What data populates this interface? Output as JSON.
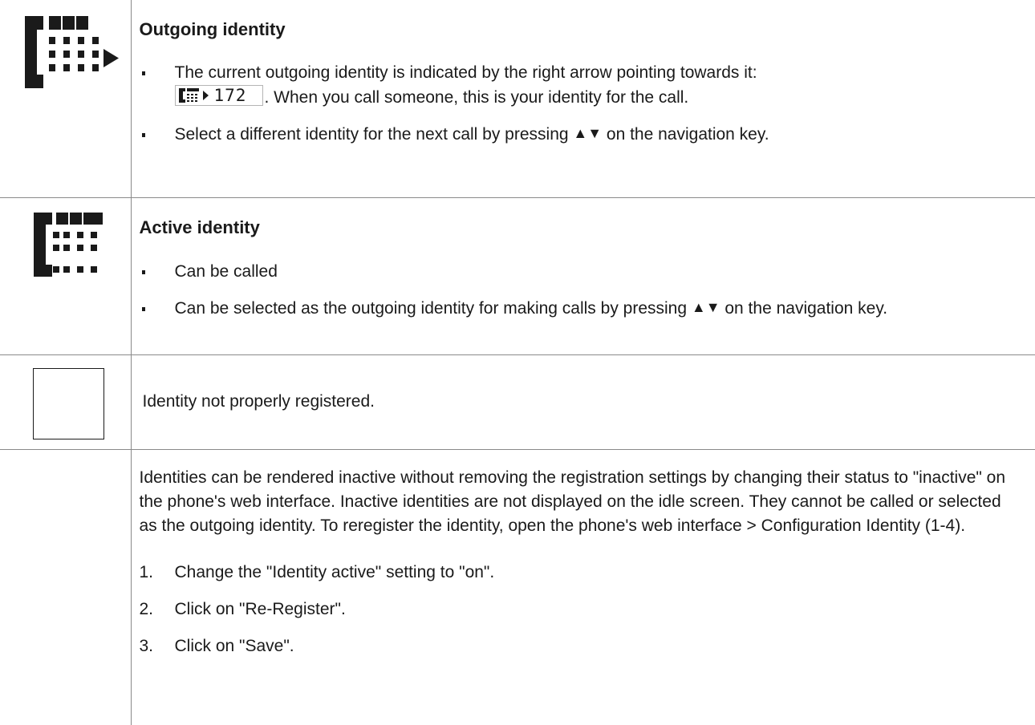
{
  "rows": [
    {
      "heading": "Outgoing identity",
      "bullets": [
        {
          "line1": "The current outgoing identity is indicated by the right arrow pointing towards it:",
          "display_number": "172",
          "after_display": ". When you call someone, this is your identity for the call."
        },
        {
          "before_arrows": "Select a different identity for the next call by pressing",
          "after_arrows": "on the navigation key."
        }
      ]
    },
    {
      "heading": "Active identity",
      "bullets": [
        {
          "text": "Can be called"
        },
        {
          "before_arrows": "Can be selected as the outgoing identity for making calls by pressing",
          "after_arrows": "on the navigation key."
        }
      ]
    },
    {
      "text": "Identity not properly registered."
    },
    {
      "paragraph": "Identities can be rendered inactive without removing the registration settings by changing their status to \"inactive\" on the phone's web interface.  Inactive identities are not displayed on the idle screen.  They cannot be called or selected as the outgoing identity.  To reregister the identity, open the phone's web interface  >  Configuration Identity (1-4).",
      "steps": [
        {
          "num": "1.",
          "text": "Change the \"Identity active\" setting to \"on\"."
        },
        {
          "num": "2.",
          "text": "Click on \"Re-Register\"."
        },
        {
          "num": "3.",
          "text": "Click on \"Save\"."
        }
      ]
    }
  ],
  "icons": {
    "outgoing": "phone-outgoing-icon",
    "active": "phone-active-icon",
    "unregistered": "empty-square-icon",
    "arrows": "up-down-triangle-icon"
  }
}
